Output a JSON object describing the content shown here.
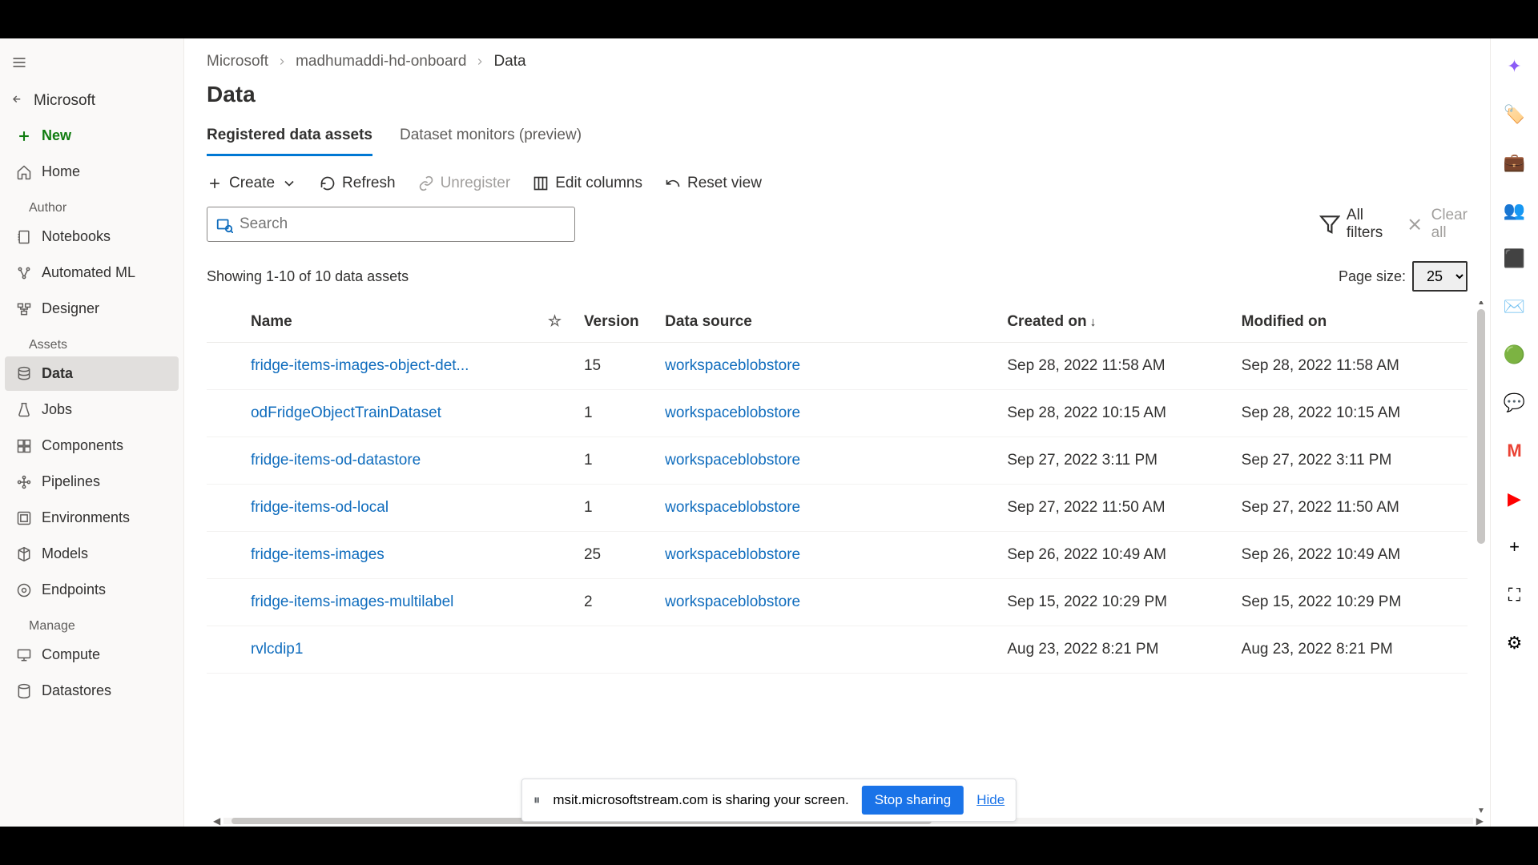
{
  "sidebar": {
    "workspace": "Microsoft",
    "new_label": "New",
    "home_label": "Home",
    "section_author": "Author",
    "section_assets": "Assets",
    "section_manage": "Manage",
    "items": {
      "notebooks": "Notebooks",
      "automl": "Automated ML",
      "designer": "Designer",
      "data": "Data",
      "jobs": "Jobs",
      "components": "Components",
      "pipelines": "Pipelines",
      "environments": "Environments",
      "models": "Models",
      "endpoints": "Endpoints",
      "compute": "Compute",
      "datastores": "Datastores"
    }
  },
  "breadcrumb": {
    "a": "Microsoft",
    "b": "madhumaddi-hd-onboard",
    "c": "Data"
  },
  "page_title": "Data",
  "tabs": {
    "assets": "Registered data assets",
    "monitors": "Dataset monitors (preview)"
  },
  "toolbar": {
    "create": "Create",
    "refresh": "Refresh",
    "unregister": "Unregister",
    "edit_cols": "Edit columns",
    "reset": "Reset view"
  },
  "search": {
    "placeholder": "Search"
  },
  "filters": {
    "all": "All filters",
    "clear": "Clear all"
  },
  "summary": "Showing 1-10 of 10 data assets",
  "page_size_label": "Page size:",
  "page_size_value": "25",
  "columns": {
    "name": "Name",
    "version": "Version",
    "source": "Data source",
    "created": "Created on",
    "modified": "Modified on"
  },
  "rows": [
    {
      "name": "fridge-items-images-object-det...",
      "version": "15",
      "source": "workspaceblobstore",
      "created": "Sep 28, 2022 11:58 AM",
      "modified": "Sep 28, 2022 11:58 AM"
    },
    {
      "name": "odFridgeObjectTrainDataset",
      "version": "1",
      "source": "workspaceblobstore",
      "created": "Sep 28, 2022 10:15 AM",
      "modified": "Sep 28, 2022 10:15 AM"
    },
    {
      "name": "fridge-items-od-datastore",
      "version": "1",
      "source": "workspaceblobstore",
      "created": "Sep 27, 2022 3:11 PM",
      "modified": "Sep 27, 2022 3:11 PM"
    },
    {
      "name": "fridge-items-od-local",
      "version": "1",
      "source": "workspaceblobstore",
      "created": "Sep 27, 2022 11:50 AM",
      "modified": "Sep 27, 2022 11:50 AM"
    },
    {
      "name": "fridge-items-images",
      "version": "25",
      "source": "workspaceblobstore",
      "created": "Sep 26, 2022 10:49 AM",
      "modified": "Sep 26, 2022 10:49 AM"
    },
    {
      "name": "fridge-items-images-multilabel",
      "version": "2",
      "source": "workspaceblobstore",
      "created": "Sep 15, 2022 10:29 PM",
      "modified": "Sep 15, 2022 10:29 PM"
    },
    {
      "name": "rvlcdip1",
      "version": "",
      "source": "",
      "created": "Aug 23, 2022 8:21 PM",
      "modified": "Aug 23, 2022 8:21 PM"
    }
  ],
  "share": {
    "msg": "msit.microsoftstream.com is sharing your screen.",
    "stop": "Stop sharing",
    "hide": "Hide"
  },
  "rail": [
    "✦",
    "🏷️",
    "💼",
    "👥",
    "⬛",
    "✉️",
    "🟢",
    "💬",
    "M",
    "▶",
    "+",
    "⛶",
    "⚙"
  ]
}
